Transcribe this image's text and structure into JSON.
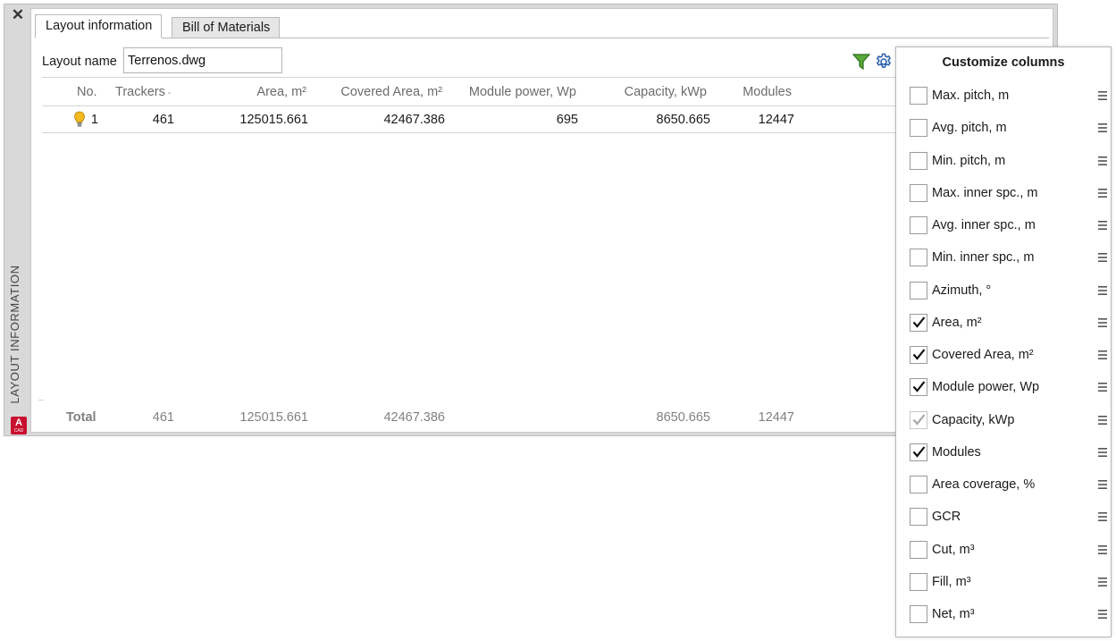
{
  "palette": {
    "vertical_title": "LAYOUT INFORMATION",
    "app_badge": "A",
    "app_badge_sub": "CAD",
    "close_icon": "close-x-icon"
  },
  "tabs": [
    {
      "label": "Layout information",
      "active": true
    },
    {
      "label": "Bill of Materials",
      "active": false
    }
  ],
  "layout": {
    "name_label": "Layout name",
    "name_value": "Terrenos.dwg"
  },
  "toolbar": {
    "filter_icon": "filter-icon",
    "settings_icon": "gear-icon",
    "filter_color": "#3a8a2a",
    "settings_color": "#2f63b0"
  },
  "table": {
    "headers": {
      "no": "No.",
      "trackers": "Trackers",
      "area": "Area, m²",
      "covered_area": "Covered Area, m²",
      "module_power": "Module power, Wp",
      "capacity": "Capacity, kWp",
      "modules": "Modules"
    },
    "rows": [
      {
        "icon": "lightbulb-icon",
        "no": "1",
        "trackers": "461",
        "area": "125015.661",
        "covered_area": "42467.386",
        "module_power": "695",
        "capacity": "8650.665",
        "modules": "12447"
      }
    ],
    "total": {
      "label": "Total",
      "trackers": "461",
      "area": "125015.661",
      "covered_area": "42467.386",
      "capacity": "8650.665",
      "modules": "12447"
    }
  },
  "customize": {
    "title": "Customize columns",
    "options": [
      {
        "label": "Max. pitch, m",
        "checked": false,
        "disabled": false
      },
      {
        "label": "Avg. pitch, m",
        "checked": false,
        "disabled": false
      },
      {
        "label": "Min. pitch, m",
        "checked": false,
        "disabled": false
      },
      {
        "label": "Max. inner spc., m",
        "checked": false,
        "disabled": false
      },
      {
        "label": "Avg. inner spc., m",
        "checked": false,
        "disabled": false
      },
      {
        "label": "Min. inner spc., m",
        "checked": false,
        "disabled": false
      },
      {
        "label": "Azimuth, °",
        "checked": false,
        "disabled": false
      },
      {
        "label": "Area, m²",
        "checked": true,
        "disabled": false
      },
      {
        "label": "Covered Area, m²",
        "checked": true,
        "disabled": false
      },
      {
        "label": "Module power, Wp",
        "checked": true,
        "disabled": false
      },
      {
        "label": "Capacity, kWp",
        "checked": true,
        "disabled": true
      },
      {
        "label": "Modules",
        "checked": true,
        "disabled": false
      },
      {
        "label": "Area coverage, %",
        "checked": false,
        "disabled": false
      },
      {
        "label": "GCR",
        "checked": false,
        "disabled": false
      },
      {
        "label": "Cut, m³",
        "checked": false,
        "disabled": false
      },
      {
        "label": "Fill, m³",
        "checked": false,
        "disabled": false
      },
      {
        "label": "Net, m³",
        "checked": false,
        "disabled": false
      }
    ]
  }
}
